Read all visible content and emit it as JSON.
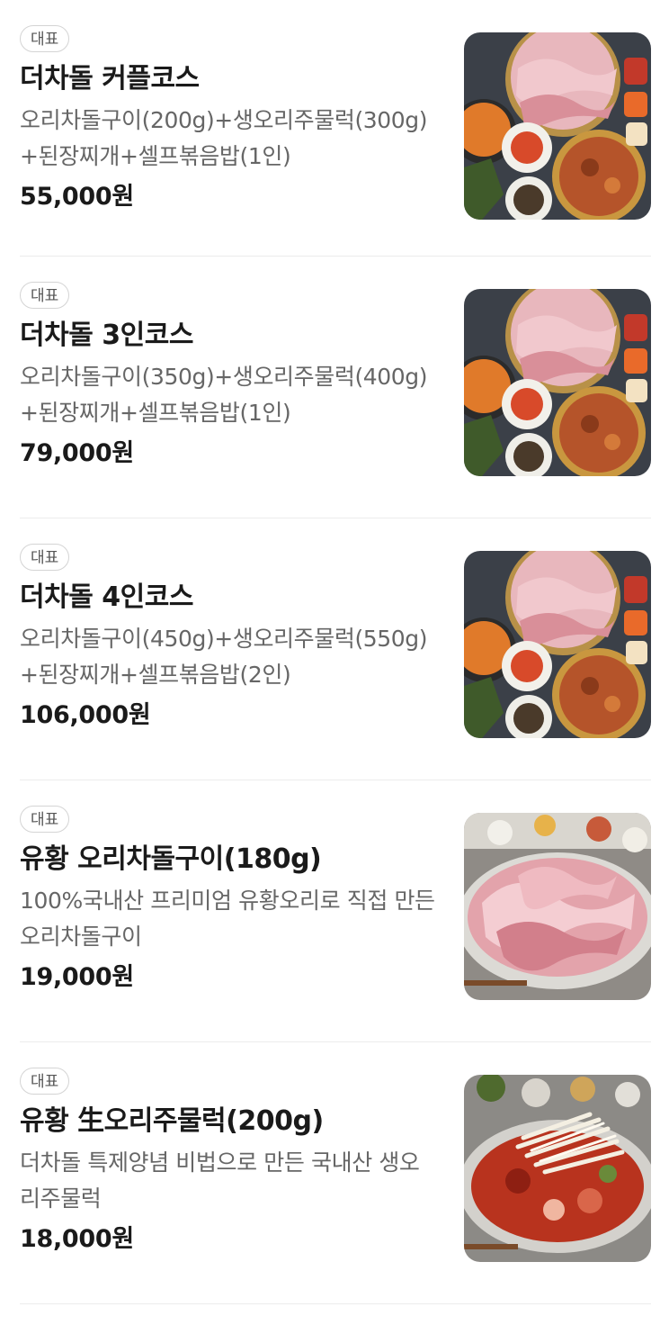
{
  "menu": {
    "items": [
      {
        "badge": "대표",
        "name": "더차돌 커플코스",
        "description": "오리차돌구이(200g)+생오리주물럭(300g)+된장찌개+셀프볶음밥(1인)",
        "price": "55,000원",
        "image": "course-platter"
      },
      {
        "badge": "대표",
        "name": "더차돌 3인코스",
        "description": "오리차돌구이(350g)+생오리주물럭(400g)+된장찌개+셀프볶음밥(1인)",
        "price": "79,000원",
        "image": "course-platter"
      },
      {
        "badge": "대표",
        "name": "더차돌 4인코스",
        "description": "오리차돌구이(450g)+생오리주물럭(550g)+된장찌개+셀프볶음밥(2인)",
        "price": "106,000원",
        "image": "course-platter"
      },
      {
        "badge": "대표",
        "name": "유황 오리차돌구이(180g)",
        "description": "100%국내산 프리미엄 유황오리로 직접 만든 오리차돌구이",
        "price": "19,000원",
        "image": "sliced-duck-plate"
      },
      {
        "badge": "대표",
        "name": "유황 生오리주물럭(200g)",
        "description": "더차돌 특제양념 비법으로 만든 국내산 생오리주물럭",
        "price": "18,000원",
        "image": "spicy-duck-plate"
      }
    ]
  },
  "colors": {
    "badge_border": "#d4d4d4",
    "divider": "#ececec",
    "name_text": "#1a1a1a",
    "desc_text": "#666666"
  }
}
